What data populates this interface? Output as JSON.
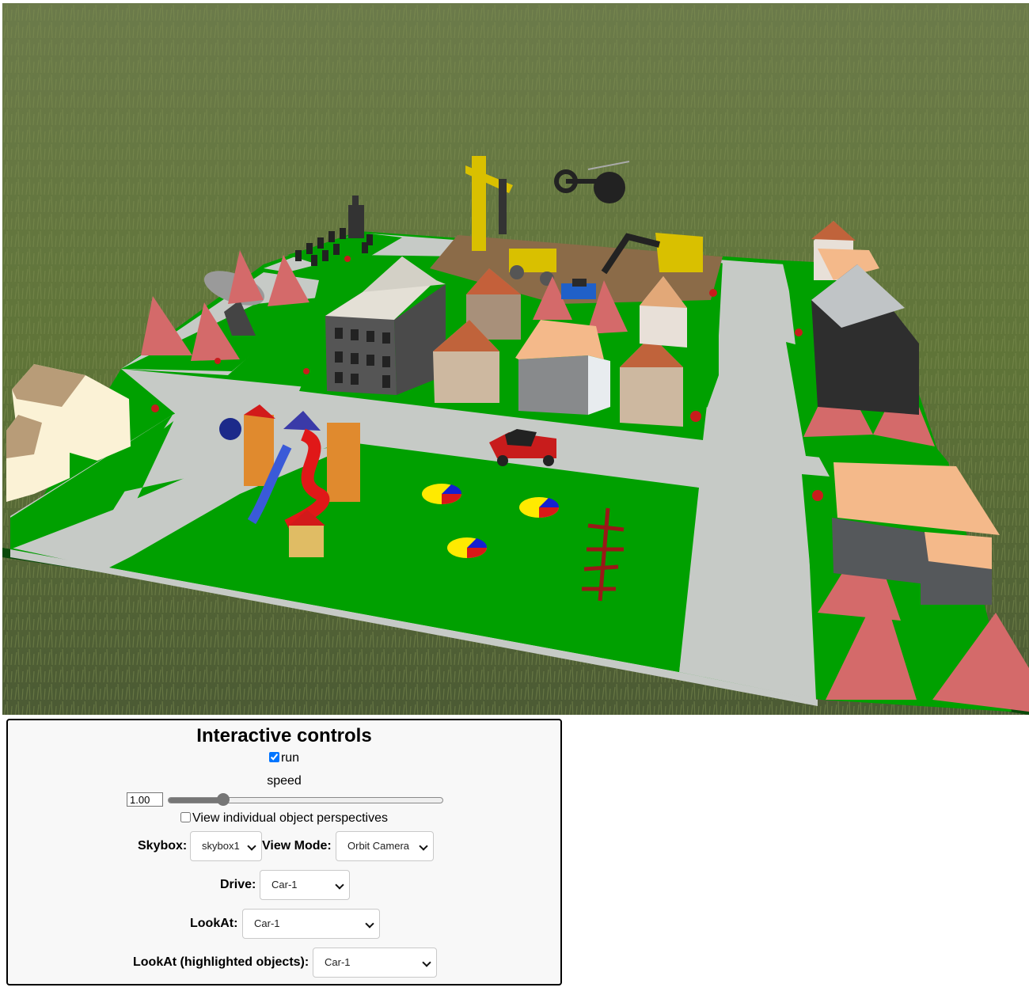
{
  "scene": {
    "description_icon": "3d-city-scene",
    "colors": {
      "grass": "#00a000",
      "road": "#c8ccc8",
      "tree": "#d46a6a",
      "dirt": "#8b6b48"
    }
  },
  "controls": {
    "title": "Interactive controls",
    "run_label": "run",
    "run_checked": true,
    "speed_label": "speed",
    "speed_value": "1.00",
    "speed_fraction": 0.2,
    "perspectives_label": "View individual object perspectives",
    "perspectives_checked": false,
    "skybox_label": "Skybox:",
    "skybox_value": "skybox1",
    "viewmode_label": "View Mode:",
    "viewmode_value": "Orbit Camera",
    "drive_label": "Drive:",
    "drive_value": "Car-1",
    "lookat_label": "LookAt:",
    "lookat_value": "Car-1",
    "lookat_highlight_label": "LookAt (highlighted objects):",
    "lookat_highlight_value": "Car-1"
  }
}
